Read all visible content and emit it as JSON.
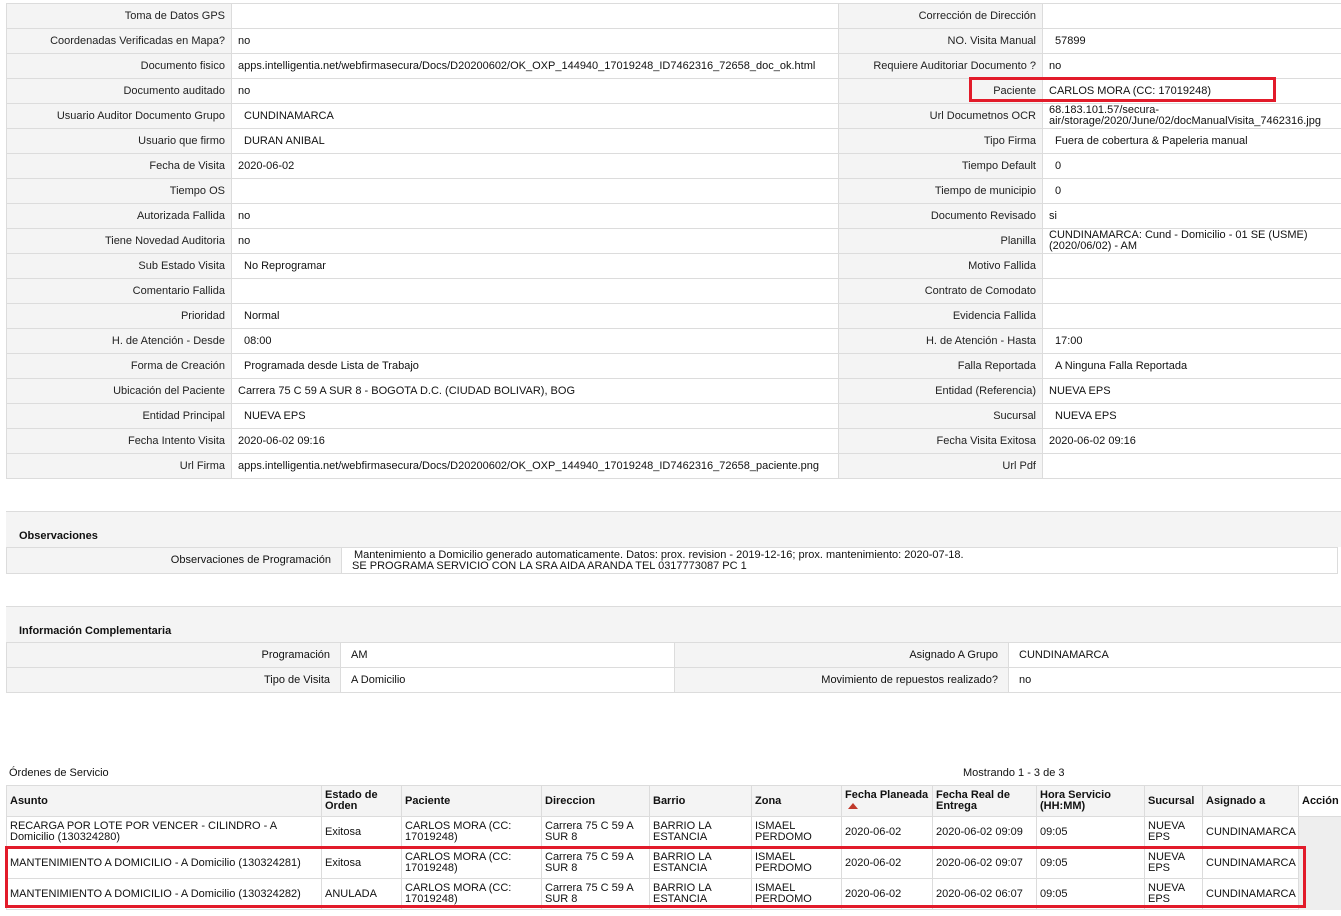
{
  "details": [
    {
      "l1": "Toma de Datos GPS",
      "v1": "",
      "l2": "Corrección de Dirección",
      "v2": ""
    },
    {
      "l1": "Coordenadas Verificadas en Mapa?",
      "v1": "no",
      "l2": "NO. Visita Manual",
      "v2": "57899"
    },
    {
      "l1": "Documento fisico",
      "v1": "apps.intelligentia.net/webfirmasecura/Docs/D20200602/OK_OXP_144940_17019248_ID7462316_72658_doc_ok.html",
      "l2": "Requiere Auditoriar Documento ?",
      "v2": "no"
    },
    {
      "l1": "Documento auditado",
      "v1": "no",
      "l2": "Paciente",
      "v2": "CARLOS MORA (CC: 17019248)"
    },
    {
      "l1": "Usuario Auditor Documento Grupo",
      "v1": "CUNDINAMARCA",
      "l2": "Url Documetnos OCR",
      "v2": "68.183.101.57/secura-air/storage/2020/June/02/docManualVisita_7462316.jpg"
    },
    {
      "l1": "Usuario que firmo",
      "v1": "DURAN ANIBAL",
      "l2": "Tipo Firma",
      "v2": "Fuera de cobertura & Papeleria manual"
    },
    {
      "l1": "Fecha de Visita",
      "v1": "2020-06-02",
      "l2": "Tiempo Default",
      "v2": "0"
    },
    {
      "l1": "Tiempo OS",
      "v1": "",
      "l2": "Tiempo de municipio",
      "v2": "0"
    },
    {
      "l1": "Autorizada Fallida",
      "v1": "no",
      "l2": "Documento Revisado",
      "v2": "si"
    },
    {
      "l1": "Tiene Novedad Auditoria",
      "v1": "no",
      "l2": "Planilla",
      "v2": "CUNDINAMARCA: Cund - Domicilio - 01 SE (USME) (2020/06/02) - AM"
    },
    {
      "l1": "Sub Estado Visita",
      "v1": "No Reprogramar",
      "l2": "Motivo Fallida",
      "v2": ""
    },
    {
      "l1": "Comentario Fallida",
      "v1": "",
      "l2": "Contrato de Comodato",
      "v2": ""
    },
    {
      "l1": "Prioridad",
      "v1": "Normal",
      "l2": "Evidencia Fallida",
      "v2": ""
    },
    {
      "l1": "H. de Atención - Desde",
      "v1": "08:00",
      "l2": "H. de Atención - Hasta",
      "v2": "17:00"
    },
    {
      "l1": "Forma de Creación",
      "v1": "Programada desde Lista de Trabajo",
      "l2": "Falla Reportada",
      "v2": "A Ninguna Falla Reportada"
    },
    {
      "l1": "Ubicación del Paciente",
      "v1": "Carrera 75 C 59 A SUR 8 - BOGOTA D.C. (CIUDAD BOLIVAR), BOG",
      "l2": "Entidad (Referencia)",
      "v2": "NUEVA EPS"
    },
    {
      "l1": "Entidad Principal",
      "v1": "NUEVA EPS",
      "l2": "Sucursal",
      "v2": "NUEVA EPS"
    },
    {
      "l1": "Fecha Intento Visita",
      "v1": "2020-06-02 09:16",
      "l2": "Fecha Visita Exitosa",
      "v2": "2020-06-02 09:16"
    },
    {
      "l1": "Url Firma",
      "v1": "apps.intelligentia.net/webfirmasecura/Docs/D20200602/OK_OXP_144940_17019248_ID7462316_72658_paciente.png",
      "l2": "Url Pdf",
      "v2": ""
    }
  ],
  "observaciones": {
    "title": "Observaciones",
    "label": "Observaciones de Programación",
    "line1": "Mantenimiento a Domicilio generado automaticamente. Datos: prox. revision - 2019-12-16; prox. mantenimiento: 2020-07-18.",
    "line2": "SE PROGRAMA SERVICIO CON LA SRA AIDA ARANDA TEL 0317773087 PC 1"
  },
  "complementaria": {
    "title": "Información Complementaria",
    "rows": [
      {
        "l1": "Programación",
        "v1": "AM",
        "l2": "Asignado A Grupo",
        "v2": "CUNDINAMARCA"
      },
      {
        "l1": "Tipo de Visita",
        "v1": "A Domicilio",
        "l2": "Movimiento de repuestos realizado?",
        "v2": "no"
      }
    ]
  },
  "orders": {
    "title": "Órdenes de Servicio",
    "count": "Mostrando 1 - 3 de 3",
    "headers": {
      "asunto": "Asunto",
      "estado": "Estado de Orden",
      "paciente": "Paciente",
      "direccion": "Direccion",
      "barrio": "Barrio",
      "zona": "Zona",
      "fecha_planeada": "Fecha Planeada",
      "fecha_real": "Fecha Real de Entrega",
      "hora": "Hora Servicio (HH:MM)",
      "sucursal": "Sucursal",
      "asignado": "Asignado a",
      "accion": "Acción"
    },
    "rows": [
      {
        "asunto": "RECARGA POR LOTE POR VENCER - CILINDRO - A Domicilio (130324280)",
        "estado": "Exitosa",
        "paciente": "CARLOS MORA (CC: 17019248)",
        "direccion": "Carrera 75 C 59 A SUR 8",
        "barrio": "BARRIO LA ESTANCIA",
        "zona": "ISMAEL PERDOMO",
        "fecha_planeada": "2020-06-02",
        "fecha_real": "2020-06-02 09:09",
        "hora": "09:05",
        "sucursal": "NUEVA EPS",
        "asignado": "CUNDINAMARCA"
      },
      {
        "asunto": "MANTENIMIENTO A DOMICILIO - A Domicilio (130324281)",
        "estado": "Exitosa",
        "paciente": "CARLOS MORA (CC: 17019248)",
        "direccion": "Carrera 75 C 59 A SUR 8",
        "barrio": "BARRIO LA ESTANCIA",
        "zona": "ISMAEL PERDOMO",
        "fecha_planeada": "2020-06-02",
        "fecha_real": "2020-06-02 09:07",
        "hora": "09:05",
        "sucursal": "NUEVA EPS",
        "asignado": "CUNDINAMARCA"
      },
      {
        "asunto": "MANTENIMIENTO A DOMICILIO - A Domicilio (130324282)",
        "estado": "ANULADA",
        "paciente": "CARLOS MORA (CC: 17019248)",
        "direccion": "Carrera 75 C 59 A SUR 8",
        "barrio": "BARRIO LA ESTANCIA",
        "zona": "ISMAEL PERDOMO",
        "fecha_planeada": "2020-06-02",
        "fecha_real": "2020-06-02 06:07",
        "hora": "09:05",
        "sucursal": "NUEVA EPS",
        "asignado": "CUNDINAMARCA"
      }
    ]
  },
  "colors": {
    "highlight": "#e21b2a",
    "label_bg": "#f4f4f4",
    "border": "#dcdcdc",
    "sort_arrow": "#c0392b"
  }
}
